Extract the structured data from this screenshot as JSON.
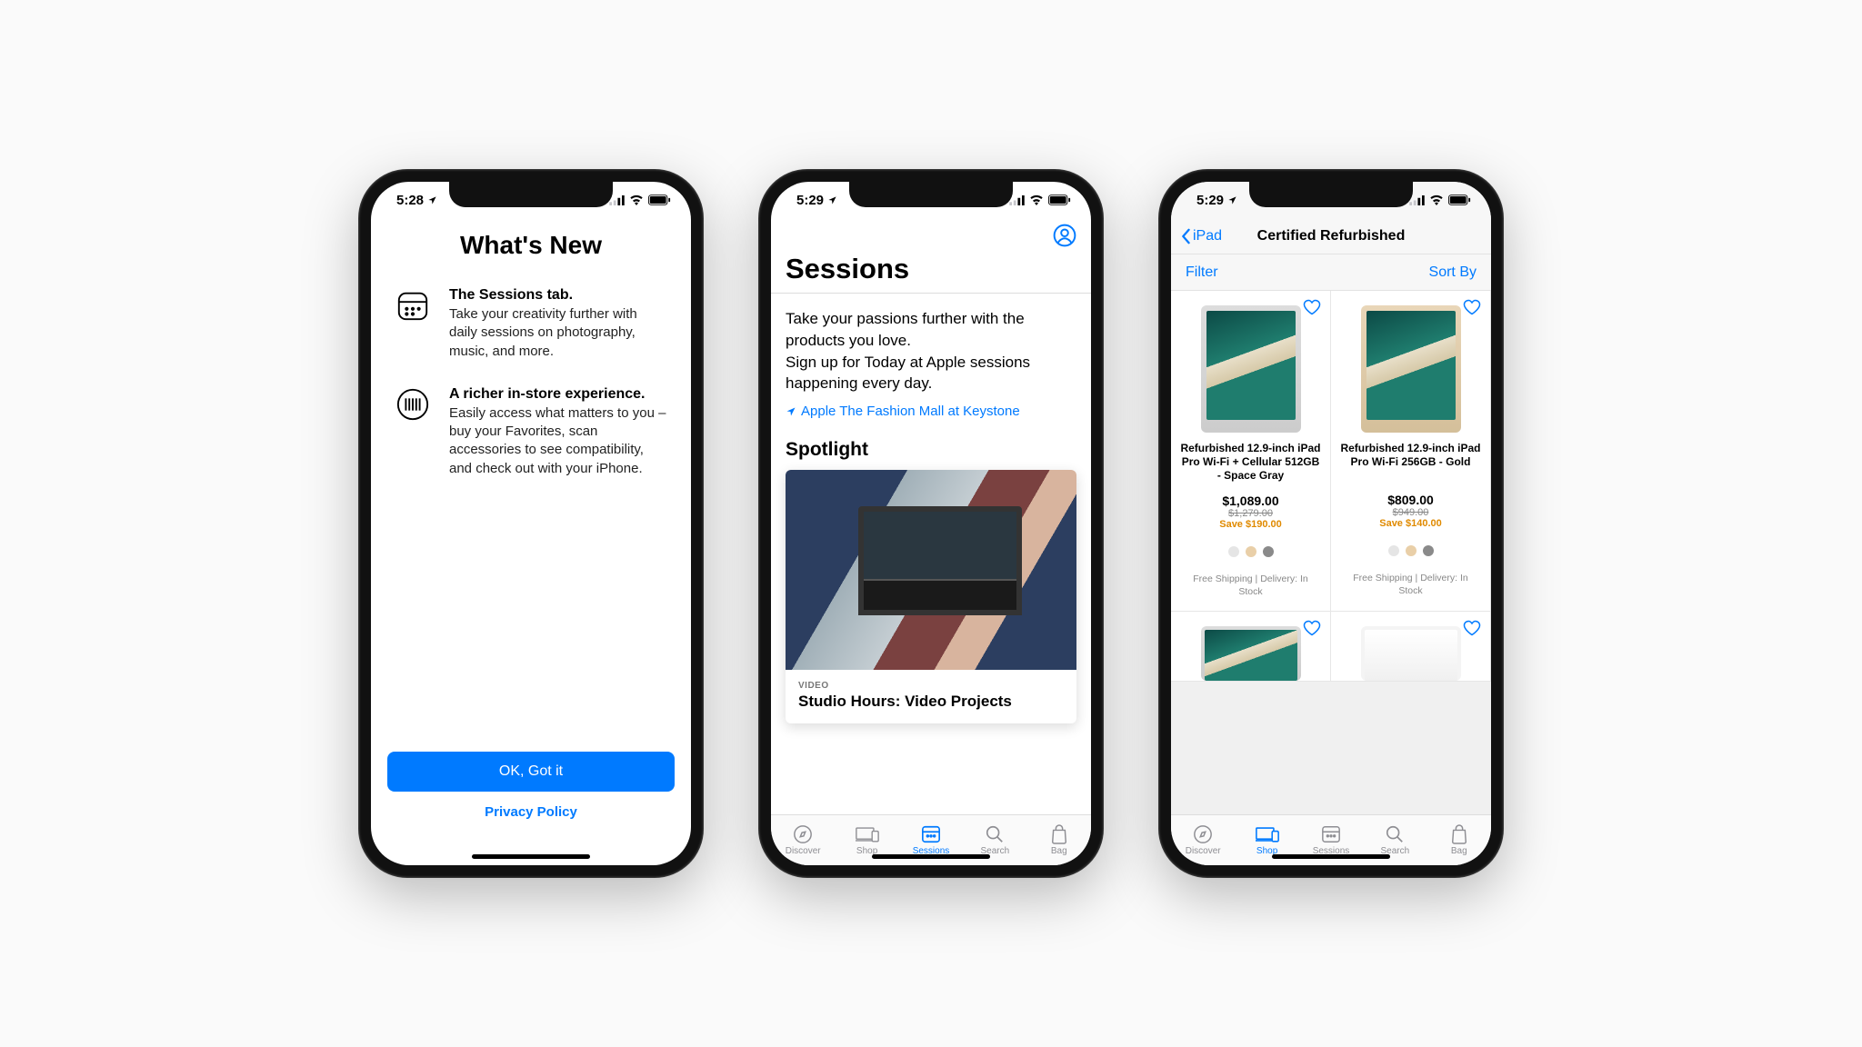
{
  "status": {
    "time1": "5:28",
    "time2": "5:29",
    "time3": "5:29"
  },
  "phone1": {
    "title": "What's New",
    "feat1_head": "The Sessions tab.",
    "feat1_body": "Take your creativity further with daily sessions on photography, music, and more.",
    "feat2_head": "A richer in-store experience.",
    "feat2_body": "Easily access what matters to you – buy your Favorites, scan accessories to see compatibility, and check out with your iPhone.",
    "cta": "OK, Got it",
    "privacy": "Privacy Policy"
  },
  "phone2": {
    "title": "Sessions",
    "intro1": "Take your passions further with the products you love.",
    "intro2": "Sign up for Today at Apple sessions happening every day.",
    "store": "Apple The Fashion Mall at Keystone",
    "section": "Spotlight",
    "eyebrow": "VIDEO",
    "card_title": "Studio Hours: Video Projects"
  },
  "tabs": {
    "discover": "Discover",
    "shop": "Shop",
    "sessions": "Sessions",
    "search": "Search",
    "bag": "Bag"
  },
  "phone3": {
    "back": "iPad",
    "title": "Certified Refurbished",
    "filter": "Filter",
    "sort": "Sort By",
    "products": [
      {
        "name": "Refurbished 12.9-inch iPad Pro Wi-Fi + Cellular 512GB - Space Gray",
        "price": "$1,089.00",
        "strike": "$1,279.00",
        "save": "Save $190.00",
        "shipping": "Free Shipping | Delivery: In Stock"
      },
      {
        "name": "Refurbished 12.9-inch iPad Pro Wi-Fi 256GB - Gold",
        "price": "$809.00",
        "strike": "$949.00",
        "save": "Save $140.00",
        "shipping": "Free Shipping | Delivery: In Stock"
      }
    ]
  }
}
